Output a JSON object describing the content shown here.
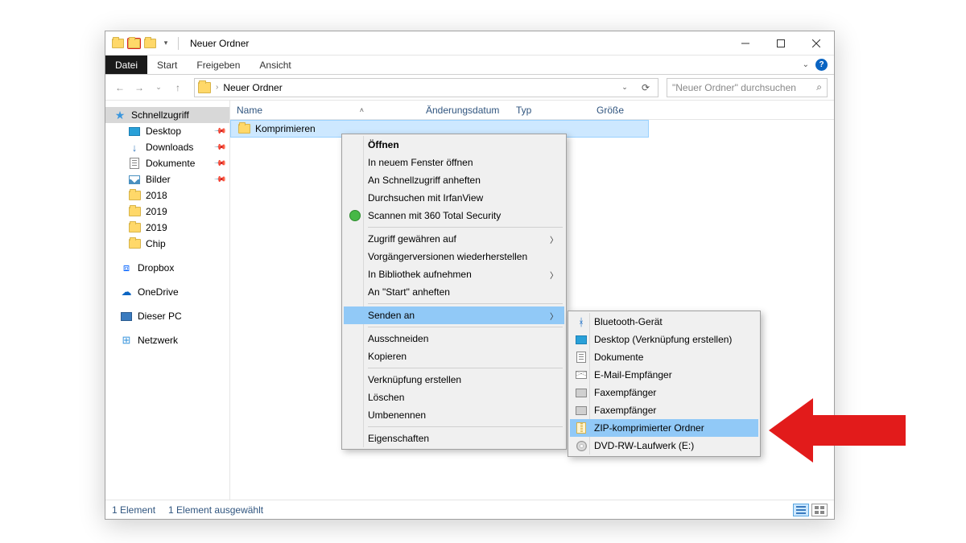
{
  "titlebar": {
    "title": "Neuer Ordner"
  },
  "ribbon": {
    "datei": "Datei",
    "start": "Start",
    "freigeben": "Freigeben",
    "ansicht": "Ansicht"
  },
  "address": {
    "path": "Neuer Ordner",
    "search_placeholder": "\"Neuer Ordner\" durchsuchen"
  },
  "sidebar": {
    "schnellzugriff": "Schnellzugriff",
    "desktop": "Desktop",
    "downloads": "Downloads",
    "dokumente": "Dokumente",
    "bilder": "Bilder",
    "y2018": "2018",
    "y2019a": "2019",
    "y2019b": "2019",
    "chip": "Chip",
    "dropbox": "Dropbox",
    "onedrive": "OneDrive",
    "dieserpc": "Dieser PC",
    "netzwerk": "Netzwerk"
  },
  "columns": {
    "name": "Name",
    "date": "Änderungsdatum",
    "type": "Typ",
    "size": "Größe"
  },
  "row": {
    "name": "Komprimieren"
  },
  "status": {
    "count": "1 Element",
    "selected": "1 Element ausgewählt"
  },
  "ctx": {
    "open": "Öffnen",
    "newwin": "In neuem Fenster öffnen",
    "pinquick": "An Schnellzugriff anheften",
    "irfan": "Durchsuchen mit IrfanView",
    "scan": "Scannen mit 360 Total Security",
    "access": "Zugriff gewähren auf",
    "restore": "Vorgängerversionen wiederherstellen",
    "library": "In Bibliothek aufnehmen",
    "pinstart": "An \"Start\" anheften",
    "sendto": "Senden an",
    "cut": "Ausschneiden",
    "copy": "Kopieren",
    "link": "Verknüpfung erstellen",
    "delete": "Löschen",
    "rename": "Umbenennen",
    "props": "Eigenschaften"
  },
  "submenu": {
    "bt": "Bluetooth-Gerät",
    "desktop": "Desktop (Verknüpfung erstellen)",
    "docs": "Dokumente",
    "mail": "E-Mail-Empfänger",
    "fax1": "Faxempfänger",
    "fax2": "Faxempfänger",
    "zip": "ZIP-komprimierter Ordner",
    "dvd": "DVD-RW-Laufwerk (E:)"
  }
}
